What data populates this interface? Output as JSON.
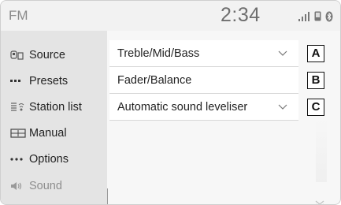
{
  "header": {
    "title": "FM",
    "clock": "2:34"
  },
  "status_icons": [
    "signal-bars-icon",
    "phone-icon",
    "bluetooth-icon"
  ],
  "sidebar": {
    "items": [
      {
        "label": "Source",
        "icon": "source-icon"
      },
      {
        "label": "Presets",
        "icon": "presets-icon"
      },
      {
        "label": "Station list",
        "icon": "station-list-icon"
      },
      {
        "label": "Manual",
        "icon": "manual-icon"
      },
      {
        "label": "Options",
        "icon": "options-icon"
      },
      {
        "label": "Sound",
        "icon": "speaker-icon",
        "active": true
      }
    ]
  },
  "menu": {
    "rows": [
      {
        "label": "Treble/Mid/Bass",
        "badge": "A",
        "has_chevron": true
      },
      {
        "label": "Fader/Balance",
        "badge": "B",
        "has_chevron": false
      },
      {
        "label": "Automatic sound leveliser",
        "badge": "C",
        "has_chevron": true
      }
    ]
  },
  "colors": {
    "sidebar_bg": "#e4e4e4",
    "row_bg": "#ffffff",
    "dim_text": "#8d8d8d"
  }
}
